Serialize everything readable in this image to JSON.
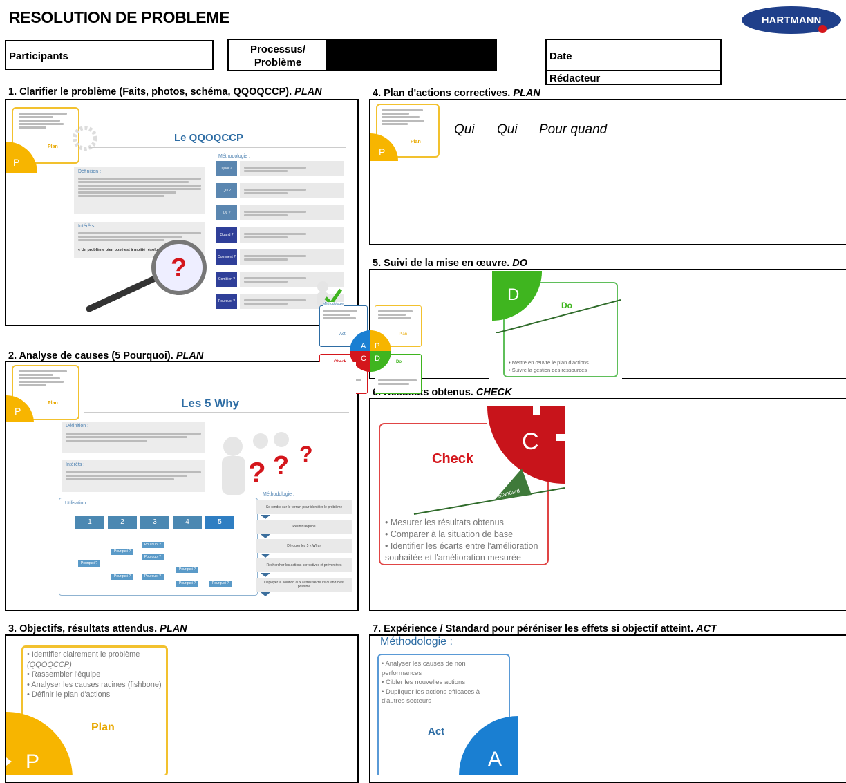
{
  "header": {
    "title": "RESOLUTION DE PROBLEME",
    "logo_text": "HARTMANN",
    "participants_label": "Participants",
    "processus_label_line1": "Processus/",
    "processus_label_line2": "Problème",
    "date_label": "Date",
    "redacteur_label": "Rédacteur"
  },
  "sections": {
    "s1": {
      "label": "1. Clarifier le problème (Faits, photos, schéma, QQOQCCP). ",
      "tag": "PLAN"
    },
    "s2": {
      "label": "2. Analyse de causes (5 Pourquoi). ",
      "tag": "PLAN"
    },
    "s3": {
      "label": "3. Objectifs, résultats attendus. ",
      "tag": "PLAN"
    },
    "s4": {
      "label": "4. Plan d'actions correctives. ",
      "tag": "PLAN"
    },
    "s5": {
      "label": "5. Suivi de la mise en œuvre. ",
      "tag": "DO"
    },
    "s6": {
      "label": "6. Résultats obtenus. ",
      "tag": "CHECK"
    },
    "s7": {
      "label": "7. Expérience / Standard pour péréniser les effets si objectif atteint. ",
      "tag": "ACT"
    }
  },
  "qqoqccp": {
    "title": "Le QQOQCCP",
    "methodologie": "Méthodologie :",
    "definition_title": "Définition :",
    "interets_title": "Intérêts :",
    "quote": "« Un problème bien posé est à moitié résolu »",
    "steps": [
      "Quoi ?",
      "Qui ?",
      "Où ?",
      "Quand ?",
      "Comment ?",
      "Combien ?",
      "Pourquoi ?"
    ]
  },
  "plan4": {
    "col1": "Qui",
    "col2": "Qui",
    "col3": "Pour quand"
  },
  "pdca": {
    "plan": "Plan",
    "do": "Do",
    "check": "Check",
    "act": "Act",
    "p": "P",
    "d": "D",
    "c": "C",
    "a": "A",
    "standard": "Standard",
    "methodologie": "Méthodologie"
  },
  "do_card": {
    "items": [
      "• Mettre en œuvre le plan d'actions",
      "• Suivre la gestion des ressources"
    ]
  },
  "why5": {
    "title": "Les 5 Why",
    "definition_title": "Définition :",
    "interets_title": "Intérêts :",
    "utilisation_title": "Utilisation :",
    "methodologie": "Méthodologie :",
    "numbers": [
      "1",
      "2",
      "3",
      "4",
      "5"
    ],
    "pourquoi": "Pourquoi ?",
    "method_steps": [
      "Se rendre sur le terrain pour identifier le problème",
      "Réunir l'équipe",
      "Dérouler les 5 « Why»",
      "Rechercher les actions correctives et préventives",
      "Déployer la solution aux autres secteurs quand c'est possible"
    ]
  },
  "check_card": {
    "items": [
      "• Mesurer les résultats obtenus",
      "• Comparer à la situation de base",
      "• Identifier les écarts entre l'amélioration",
      "souhaitée et l'amélioration mesurée"
    ]
  },
  "plan_card": {
    "items": [
      "• Identifier   clairement   le   problème",
      "(QQOQCCP)",
      "• Rassembler l'équipe",
      "• Analyser les causes racines (fishbone)",
      "• Définir le plan d'actions"
    ]
  },
  "act_card": {
    "methodologie": "Méthodologie :",
    "items": [
      "• Analyser les causes de non",
      "performances",
      "• Cibler les nouvelles actions",
      "• Dupliquer les actions efficaces à",
      "d'autres secteurs"
    ]
  },
  "colors": {
    "plan": "#f7b500",
    "do": "#3fb51f",
    "check": "#d4161c",
    "act": "#1a7fd2",
    "blue_title": "#2e6da4"
  }
}
